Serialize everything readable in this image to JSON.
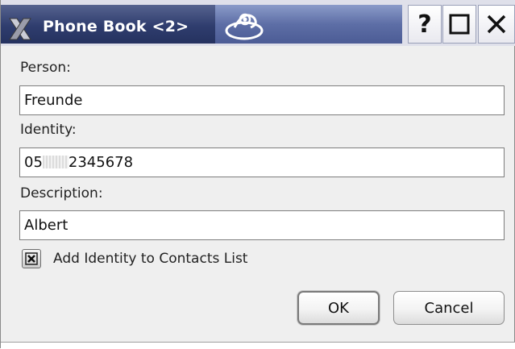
{
  "window": {
    "title": "Phone Book <2>"
  },
  "titlebar": {
    "help_label": "?"
  },
  "form": {
    "person_label": "Person:",
    "person_value": "Freunde",
    "identity_label": "Identity:",
    "identity_prefix": "05",
    "identity_suffix": "2345678",
    "description_label": "Description:",
    "description_value": "Albert",
    "add_to_contacts_label": "Add Identity to Contacts List",
    "add_to_contacts_checked": true
  },
  "buttons": {
    "ok_label": "OK",
    "cancel_label": "Cancel"
  },
  "icons": {
    "app": "x-logo-icon",
    "swirl": "swirl-decoration-icon",
    "maximize": "maximize-icon",
    "close": "close-icon",
    "check": "check-x-icon"
  },
  "colors": {
    "title_bar": "#2f3d6e",
    "title_text": "#ffffff",
    "dialog_bg": "#efefef"
  }
}
